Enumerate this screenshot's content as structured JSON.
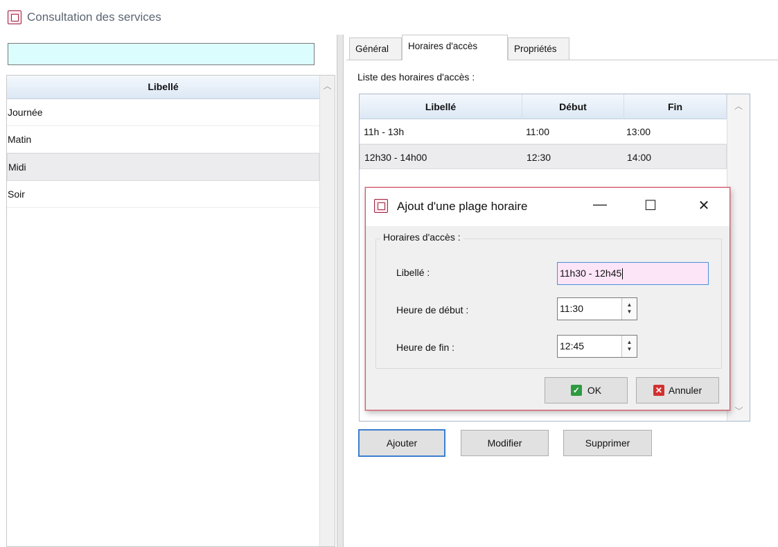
{
  "window": {
    "title": "Consultation des services",
    "icon": "service-app-icon"
  },
  "search": {
    "value": ""
  },
  "service_list": {
    "header": "Libellé",
    "items": [
      "Journée",
      "Matin",
      "Midi",
      "Soir"
    ],
    "selected_index": 2
  },
  "tabs": [
    {
      "label": "Général"
    },
    {
      "label": "Horaires d'accès"
    },
    {
      "label": "Propriétés"
    }
  ],
  "active_tab": 1,
  "access_list": {
    "label": "Liste des horaires d'accès :",
    "columns": [
      "Libellé",
      "Début",
      "Fin"
    ],
    "rows": [
      {
        "libelle": "11h - 13h",
        "debut": "11:00",
        "fin": "13:00"
      },
      {
        "libelle": "12h30 - 14h00",
        "debut": "12:30",
        "fin": "14:00"
      }
    ],
    "selected_index": 1
  },
  "actions": {
    "add": "Ajouter",
    "edit": "Modifier",
    "delete": "Supprimer"
  },
  "dialog": {
    "title": "Ajout d'une plage horaire",
    "group_label": "Horaires d'accès :",
    "fields": {
      "name_label": "Libellé :",
      "name_value": "11h30 - 12h45",
      "start_label": "Heure de début :",
      "start_value": "11:30",
      "end_label": "Heure de fin :",
      "end_value": "12:45"
    },
    "ok": "OK",
    "cancel": "Annuler",
    "window_controls": {
      "minimize": "—",
      "maximize": "☐",
      "close": "✕"
    }
  },
  "colors": {
    "search_bg": "#dcfdfd",
    "name_field_bg": "#fde5f8",
    "dialog_border": "#d45b6b",
    "default_button_border": "#3b7fd1"
  }
}
